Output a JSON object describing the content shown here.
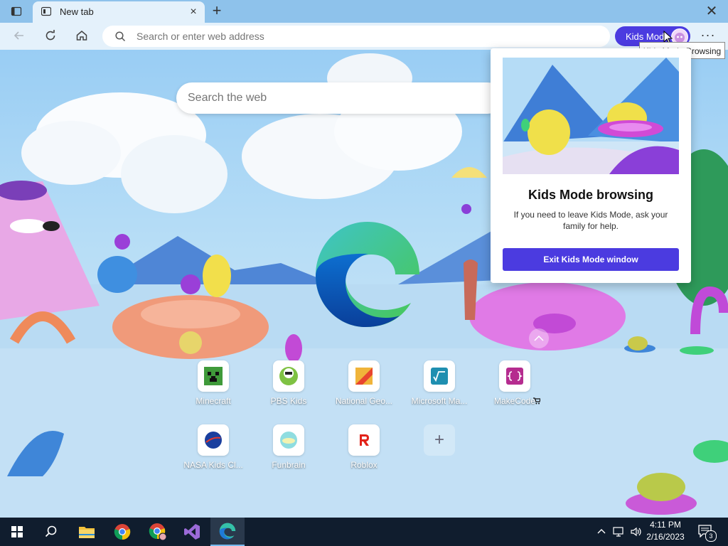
{
  "tab": {
    "title": "New tab",
    "close_glyph": "×",
    "new_glyph": "+"
  },
  "window": {
    "close_glyph": "✕"
  },
  "toolbar": {
    "address_placeholder": "Search or enter web address",
    "kids_mode_label": "Kids Mode",
    "more_glyph": "···",
    "tooltip": "Kids Mode Browsing"
  },
  "ntp": {
    "search_placeholder": "Search the web",
    "tiles": [
      {
        "label": "Minecraft",
        "icon": "minecraft-icon"
      },
      {
        "label": "PBS Kids",
        "icon": "pbs-kids-icon"
      },
      {
        "label": "National Geo...",
        "icon": "national-geographic-icon"
      },
      {
        "label": "Microsoft Ma...",
        "icon": "microsoft-math-icon"
      },
      {
        "label": "MakeCode",
        "icon": "makecode-icon"
      },
      {
        "label": "NASA Kids Cl...",
        "icon": "nasa-icon"
      },
      {
        "label": "Funbrain",
        "icon": "funbrain-icon"
      },
      {
        "label": "Roblox",
        "icon": "roblox-icon"
      }
    ],
    "add_glyph": "+"
  },
  "flyout": {
    "title": "Kids Mode browsing",
    "description": "If you need to leave Kids Mode, ask your family for help.",
    "exit_button": "Exit Kids Mode window"
  },
  "taskbar": {
    "time": "4:11 PM",
    "date": "2/16/2023",
    "notification_count": "3"
  },
  "colors": {
    "accent": "#4b3be0",
    "tabstrip": "#8ec2eb",
    "toolbar": "#e4f1fb",
    "taskbar": "#101d2e"
  }
}
